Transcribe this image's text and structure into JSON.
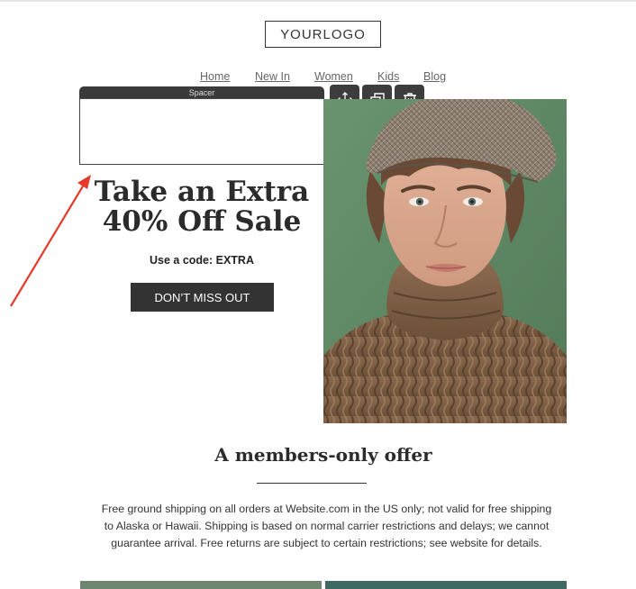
{
  "header": {
    "logo_text": "YOURLOGO"
  },
  "nav": {
    "items": [
      "Home",
      "New In",
      "Women",
      "Kids",
      "Blog"
    ]
  },
  "spacer": {
    "label": "Spacer"
  },
  "toolbar": {
    "move_icon": "move-icon",
    "duplicate_icon": "duplicate-icon",
    "delete_icon": "trash-icon"
  },
  "promo": {
    "headline_line1": "Take an Extra",
    "headline_line2": "40% Off Sale",
    "code_text": "Use a code: EXTRA",
    "cta_label": "DON’T MISS OUT"
  },
  "offer": {
    "title": "A members-only offer",
    "body": "Free ground shipping on all orders at Website.com in the US only; not valid for free shipping to Alaska or Hawaii. Shipping is based on normal carrier restrictions and delays; we cannot guarantee arrival. Free returns are subject to certain restrictions; see website for details."
  },
  "colors": {
    "accent_arrow": "#e53a2b",
    "button_bg": "#333333",
    "hero_bg": "#5f8a66"
  }
}
